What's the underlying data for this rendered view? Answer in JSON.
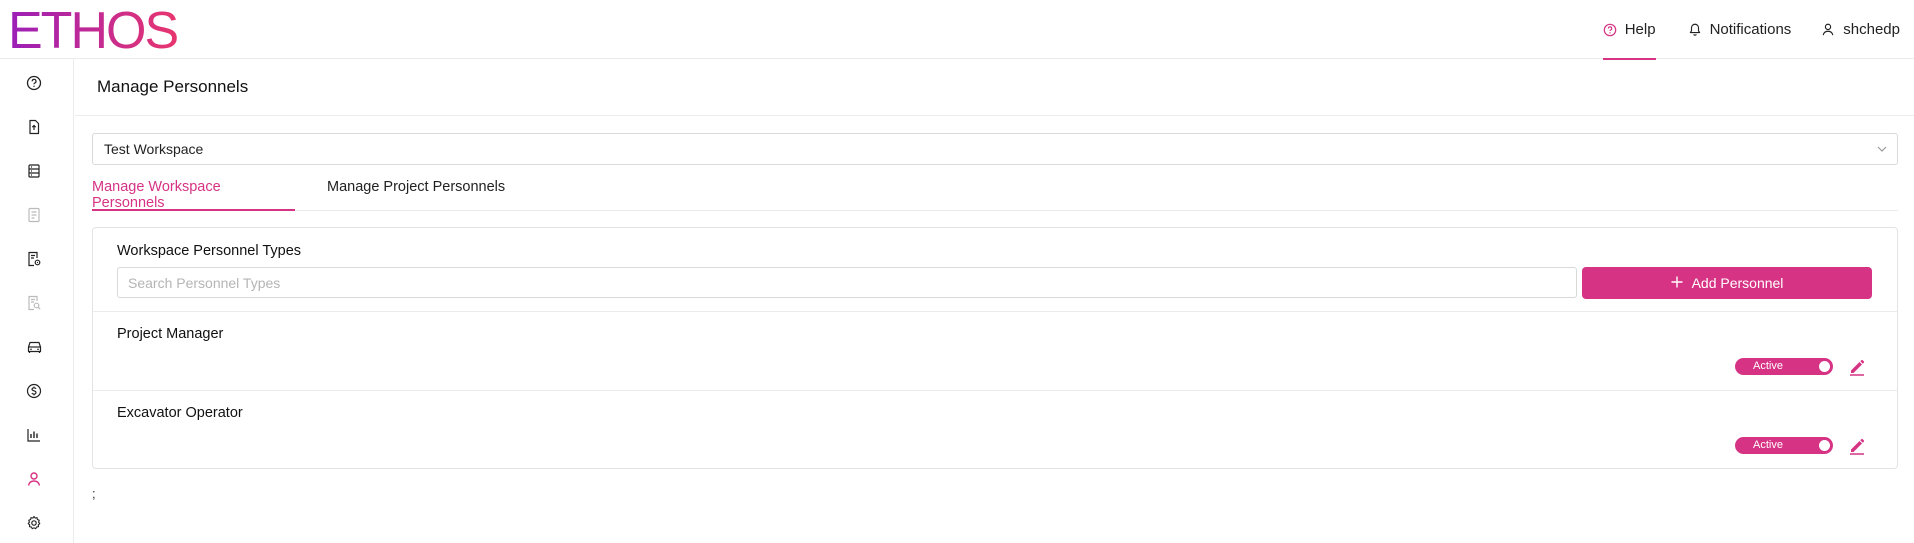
{
  "brand": {
    "logo_text": "ETHOS",
    "accent_color": "#d63384",
    "logo_gradient": [
      "#9b1fb8",
      "#e8356f"
    ]
  },
  "header": {
    "help_label": "Help",
    "notifications_label": "Notifications",
    "user_label": "shchedp"
  },
  "sidebar": {
    "icons": [
      "help-circle-icon",
      "document-upload-icon",
      "database-icon",
      "report-icon",
      "report-settings-icon",
      "report-search-icon",
      "car-icon",
      "dollar-icon",
      "bar-chart-icon",
      "user-icon",
      "gear-icon"
    ],
    "active": "user-icon"
  },
  "page": {
    "title": "Manage Personnels"
  },
  "workspace_select": {
    "value": "Test Workspace"
  },
  "tabs": [
    {
      "label": "Manage Workspace Personnels",
      "active": true
    },
    {
      "label": "Manage Project Personnels",
      "active": false
    }
  ],
  "card": {
    "title": "Workspace Personnel Types",
    "search_placeholder": "Search Personnel Types",
    "add_button_label": "Add Personnel",
    "rows": [
      {
        "name": "Project Manager",
        "status": "Active"
      },
      {
        "name": "Excavator Operator",
        "status": "Active"
      }
    ]
  },
  "footnote": ";"
}
